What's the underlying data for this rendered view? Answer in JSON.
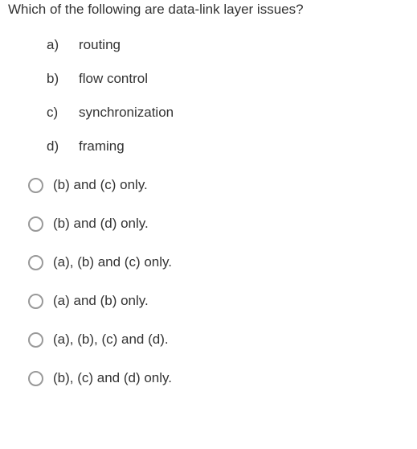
{
  "question": "Which of the following are data-link layer issues?",
  "options": [
    {
      "marker": "a)",
      "text": "routing"
    },
    {
      "marker": "b)",
      "text": "flow control"
    },
    {
      "marker": "c)",
      "text": "synchronization"
    },
    {
      "marker": "d)",
      "text": "framing"
    }
  ],
  "answers": [
    {
      "text": "(b) and (c) only."
    },
    {
      "text": "(b) and (d) only."
    },
    {
      "text": "(a), (b) and (c) only."
    },
    {
      "text": "(a) and (b) only."
    },
    {
      "text": "(a), (b), (c) and (d)."
    },
    {
      "text": "(b), (c) and (d) only."
    }
  ]
}
